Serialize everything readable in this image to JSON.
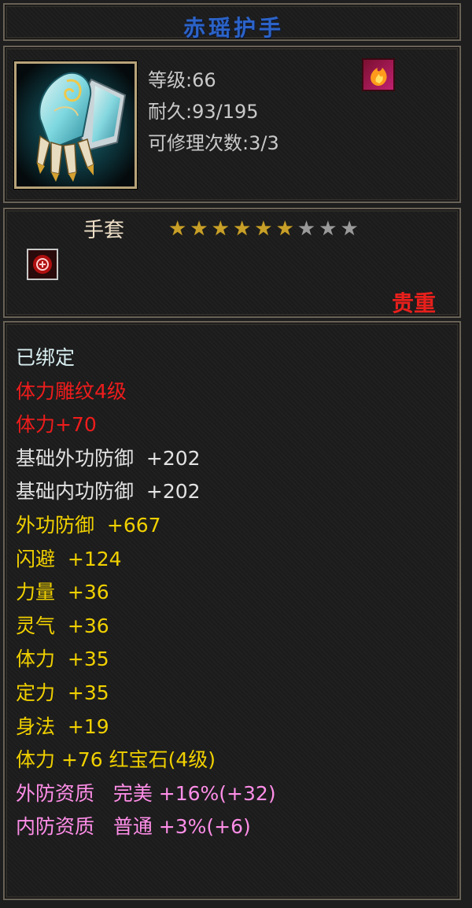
{
  "title": "赤瑶护手",
  "item": {
    "icon": "glove-icon",
    "level_line": "等级:66",
    "durability_line": "耐久:93/195",
    "repair_line": "可修理次数:3/3",
    "badge_icon": "flame-icon"
  },
  "type": {
    "label": "手套",
    "stars_filled": 6,
    "stars_total": 9,
    "seal_icon": "seal-icon",
    "rarity": "贵重"
  },
  "attributes": [
    {
      "text": "已绑定",
      "color": "#d8eef0"
    },
    {
      "text": "体力雕纹4级",
      "color": "#ee1c1c"
    },
    {
      "text": "体力+70",
      "color": "#ee1c1c"
    },
    {
      "text": "基础外功防御  +202",
      "color": "#e2e2e2"
    },
    {
      "text": "基础内功防御  +202",
      "color": "#e2e2e2"
    },
    {
      "text": "外功防御  +667",
      "color": "#f0d000"
    },
    {
      "text": "闪避  +124",
      "color": "#f0d000"
    },
    {
      "text": "力量  +36",
      "color": "#f0d000"
    },
    {
      "text": "灵气  +36",
      "color": "#f0d000"
    },
    {
      "text": "体力  +35",
      "color": "#f0d000"
    },
    {
      "text": "定力  +35",
      "color": "#f0d000"
    },
    {
      "text": "身法  +19",
      "color": "#f0d000"
    },
    {
      "text": "体力 +76 红宝石(4级)",
      "color": "#f0d000"
    },
    {
      "text": "外防资质   完美 +16%(+32)",
      "color": "#ff8ee8"
    },
    {
      "text": "内防资质   普通 +3%(+6)",
      "color": "#ff8ee8"
    }
  ],
  "colors": {
    "title": "#2c63c8",
    "border": "#6a6358",
    "star_on": "#c8a028",
    "star_off": "#9a9a9a",
    "rarity": "#e8201c"
  }
}
